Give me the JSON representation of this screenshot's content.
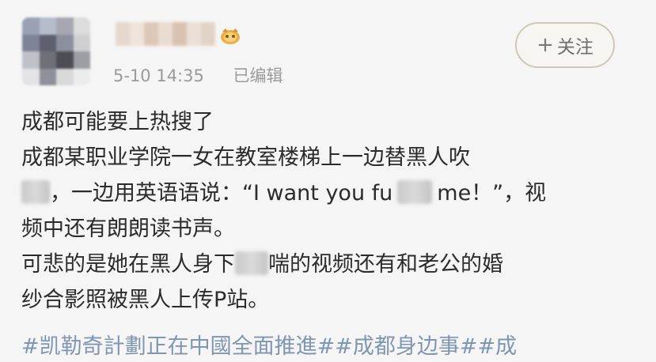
{
  "post": {
    "timestamp": "5-10 14:35",
    "edited_label": "已编辑",
    "follow_label": "关注",
    "follow_plus": "+",
    "lines": [
      "成都可能要上热搜了",
      "成都某职业学院一女在教室楼梯上一边替黑人吹",
      "，一边用英语语说：“I want you fu",
      "me！”，视",
      "频中还有朗朗读书声。",
      "可悲的是她在黑人身下",
      "喘的视频还有和老公的婚",
      "纱合影照被黑人上传P站。"
    ],
    "hashtags": "#凯勒奇計劃正在中國全面推進##成都身边事##成"
  },
  "colors": {
    "background": "#f5f5f5",
    "text": "#2b2b2b",
    "meta": "#9a9a9a",
    "hashtag": "#7f96b2",
    "follow_border": "#cfc7b9"
  }
}
